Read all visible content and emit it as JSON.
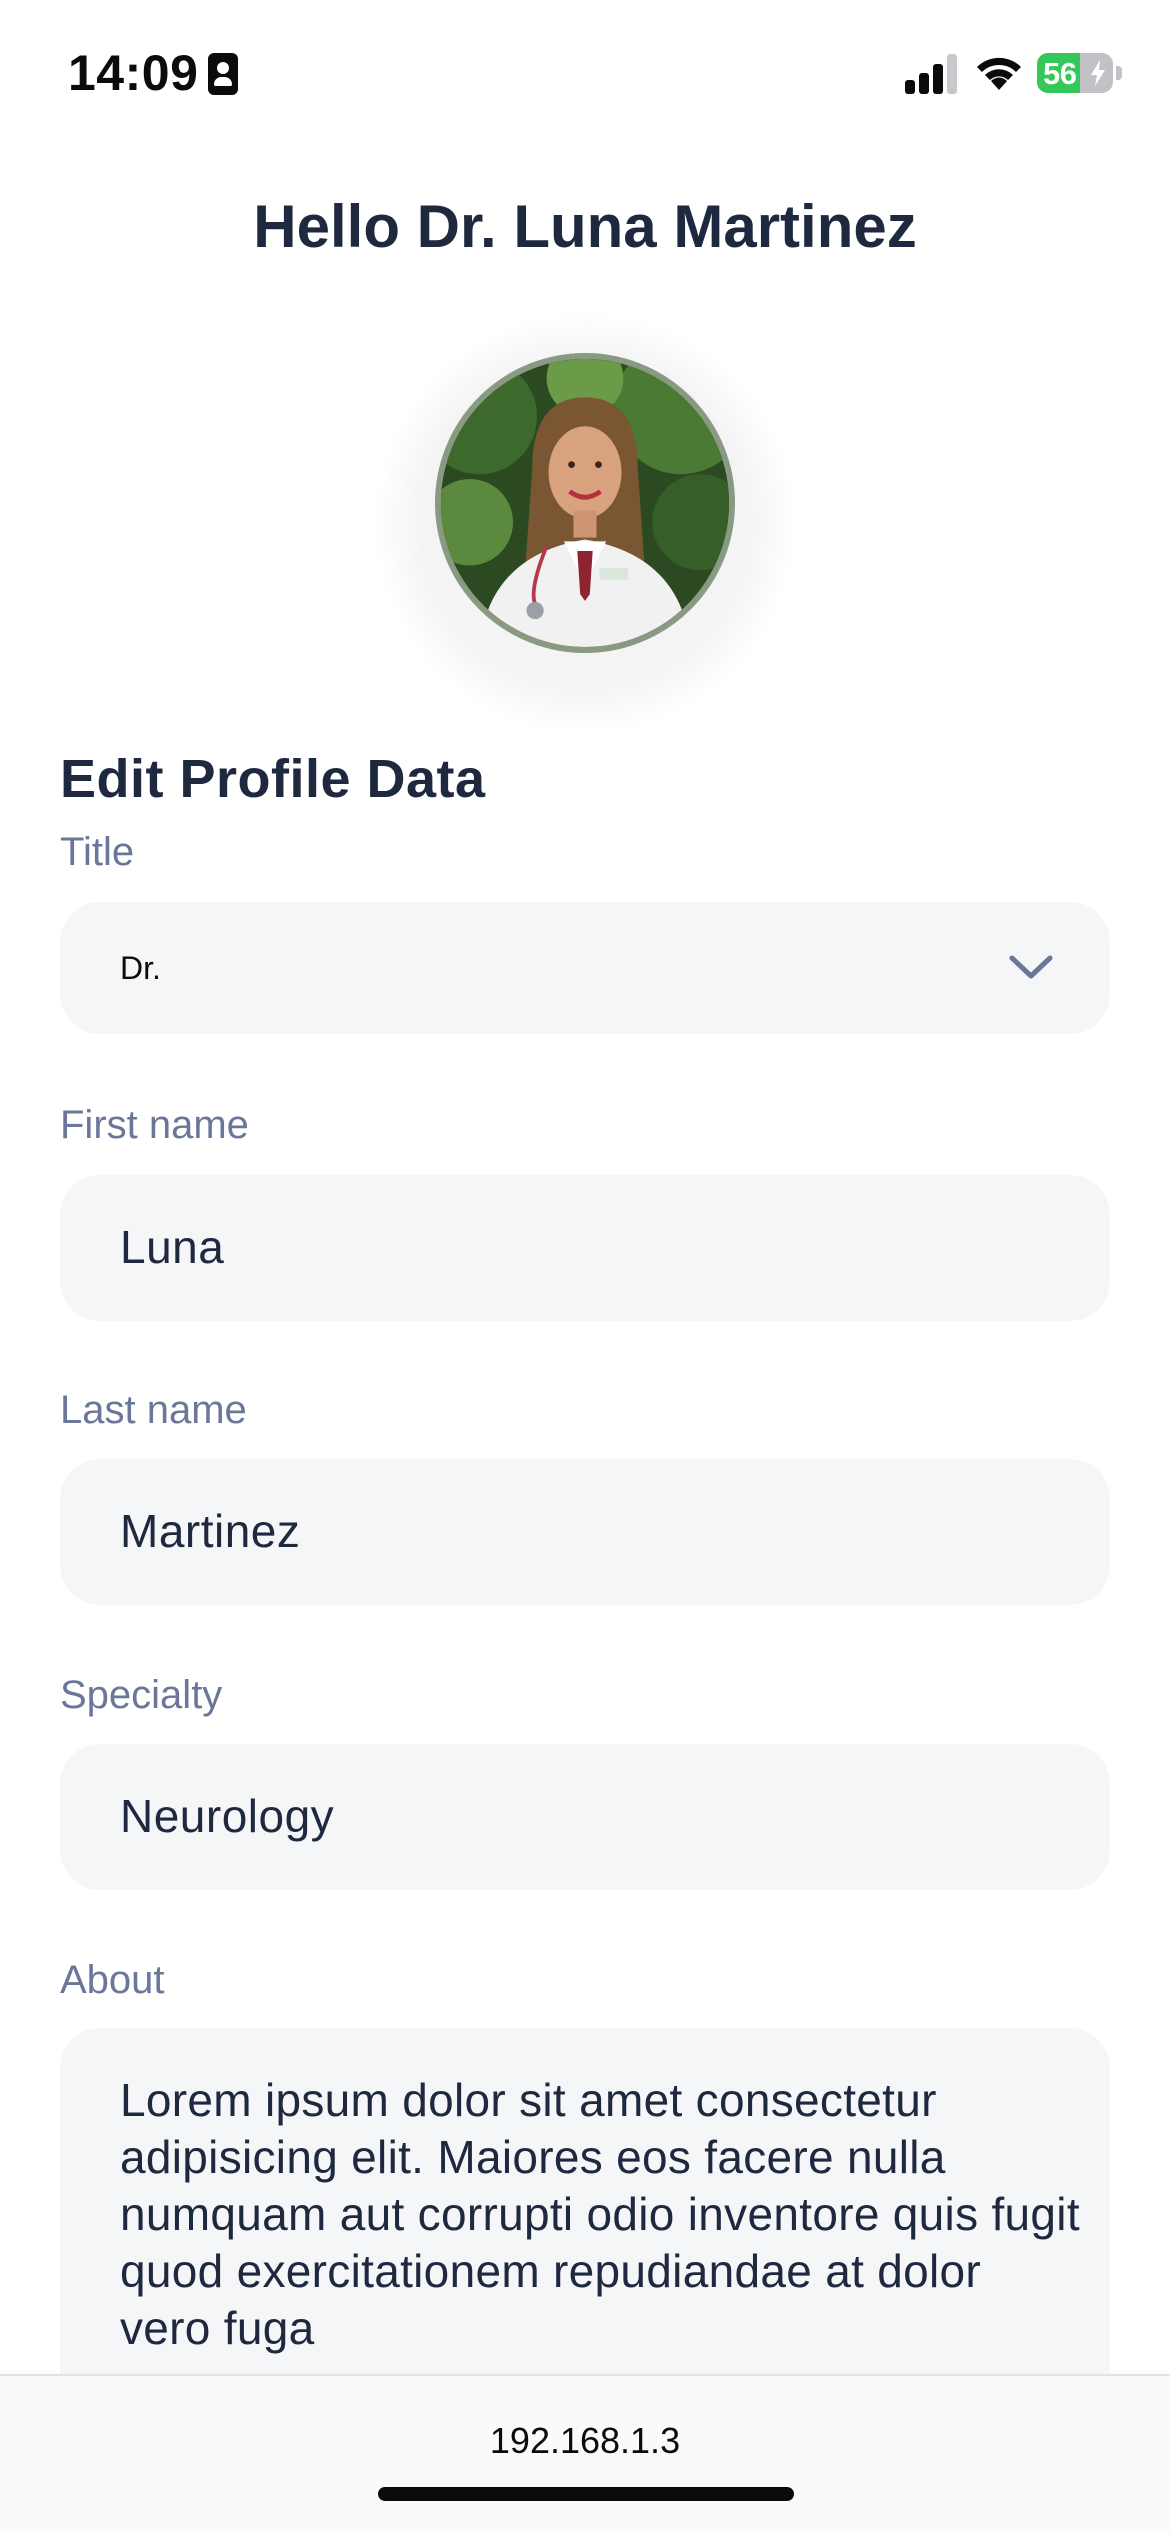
{
  "status_bar": {
    "time": "14:09",
    "battery_level": "56",
    "battery_fraction": 0.56,
    "icons": [
      "sim-card-icon",
      "cellular-signal-icon",
      "wifi-icon",
      "battery-charging-icon"
    ]
  },
  "header": {
    "greeting": "Hello Dr. Luna Martinez"
  },
  "avatar": {
    "icon": "profile-photo"
  },
  "form": {
    "heading": "Edit Profile Data",
    "title": {
      "label": "Title",
      "value": "Dr.",
      "icon": "chevron-down-icon"
    },
    "first_name": {
      "label": "First name",
      "value": "Luna"
    },
    "last_name": {
      "label": "Last name",
      "value": "Martinez"
    },
    "specialty": {
      "label": "Specialty",
      "value": "Neurology"
    },
    "about": {
      "label": "About",
      "value": "Lorem ipsum dolor sit amet consectetur adipisicing elit. Maiores eos facere nulla numquam aut corrupti odio inventore quis fugit quod exercitationem repudiandae at dolor vero fuga"
    }
  },
  "browser": {
    "url": "192.168.1.3"
  },
  "colors": {
    "text_primary": "#1e2940",
    "label": "#6a7799",
    "field_background": "#f5f6f8",
    "battery_green": "#34c759"
  }
}
